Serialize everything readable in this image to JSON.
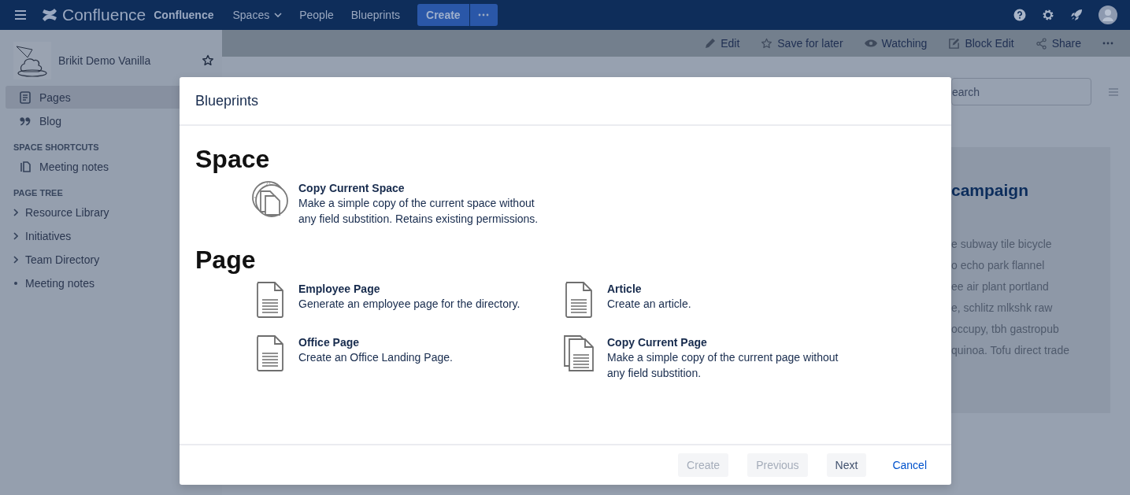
{
  "nav": {
    "brand": "Confluence",
    "brand_text": "Confluence",
    "links": [
      {
        "label": "Spaces",
        "dropdown": true
      },
      {
        "label": "People",
        "dropdown": false
      },
      {
        "label": "Blueprints",
        "dropdown": false
      }
    ],
    "create": "Create"
  },
  "toolbar": [
    {
      "label": "Edit",
      "kind": "edit"
    },
    {
      "label": "Save for later",
      "kind": "star"
    },
    {
      "label": "Watching",
      "kind": "eye"
    },
    {
      "label": "Block Edit",
      "kind": "block"
    },
    {
      "label": "Share",
      "kind": "share"
    }
  ],
  "sidebar": {
    "space_name": "Brikit Demo Vanilla",
    "nav": [
      {
        "label": "Pages",
        "kind": "page",
        "selected": true
      },
      {
        "label": "Blog",
        "kind": "quote",
        "selected": false
      }
    ],
    "shortcuts_heading": "SPACE SHORTCUTS",
    "shortcuts": [
      {
        "label": "Meeting notes"
      }
    ],
    "tree_heading": "PAGE TREE",
    "tree": [
      {
        "label": "Resource Library",
        "expandable": true
      },
      {
        "label": "Initiatives",
        "expandable": true
      },
      {
        "label": "Team Directory",
        "expandable": true
      },
      {
        "label": "Meeting notes",
        "expandable": false
      }
    ]
  },
  "page": {
    "search": {
      "placeholder": "earch"
    },
    "heading": "campaign",
    "lines": [
      "e subway tile bicycle",
      "o echo park flannel",
      "ee air plant portland",
      "e, schlitz mlkshk raw",
      "occupy, tbh gastropub",
      "quinoa. Tofu direct trade"
    ]
  },
  "modal": {
    "title": "Blueprints",
    "sections": [
      {
        "heading": "Space",
        "items": [
          {
            "title": "Copy Current Space",
            "description": "Make a simple copy of the current space without any field substition. Retains existing permissions.",
            "kind": "space"
          }
        ]
      },
      {
        "heading": "Page",
        "items": [
          {
            "title": "Employee Page",
            "description": "Generate an employee page for the directory.",
            "kind": "page"
          },
          {
            "title": "Article",
            "description": "Create an article.",
            "kind": "page"
          },
          {
            "title": "Office Page",
            "description": "Create an Office Landing Page.",
            "kind": "page"
          },
          {
            "title": "Copy Current Page",
            "description": "Make a simple copy of the current page without any field substition.",
            "kind": "copy"
          }
        ]
      }
    ],
    "buttons": [
      {
        "label": "Create",
        "kind": "button",
        "disabled": true
      },
      {
        "label": "Previous",
        "kind": "button",
        "disabled": true
      },
      {
        "label": "Next",
        "kind": "button",
        "disabled": false
      },
      {
        "label": "Cancel",
        "kind": "link",
        "disabled": false
      }
    ]
  }
}
